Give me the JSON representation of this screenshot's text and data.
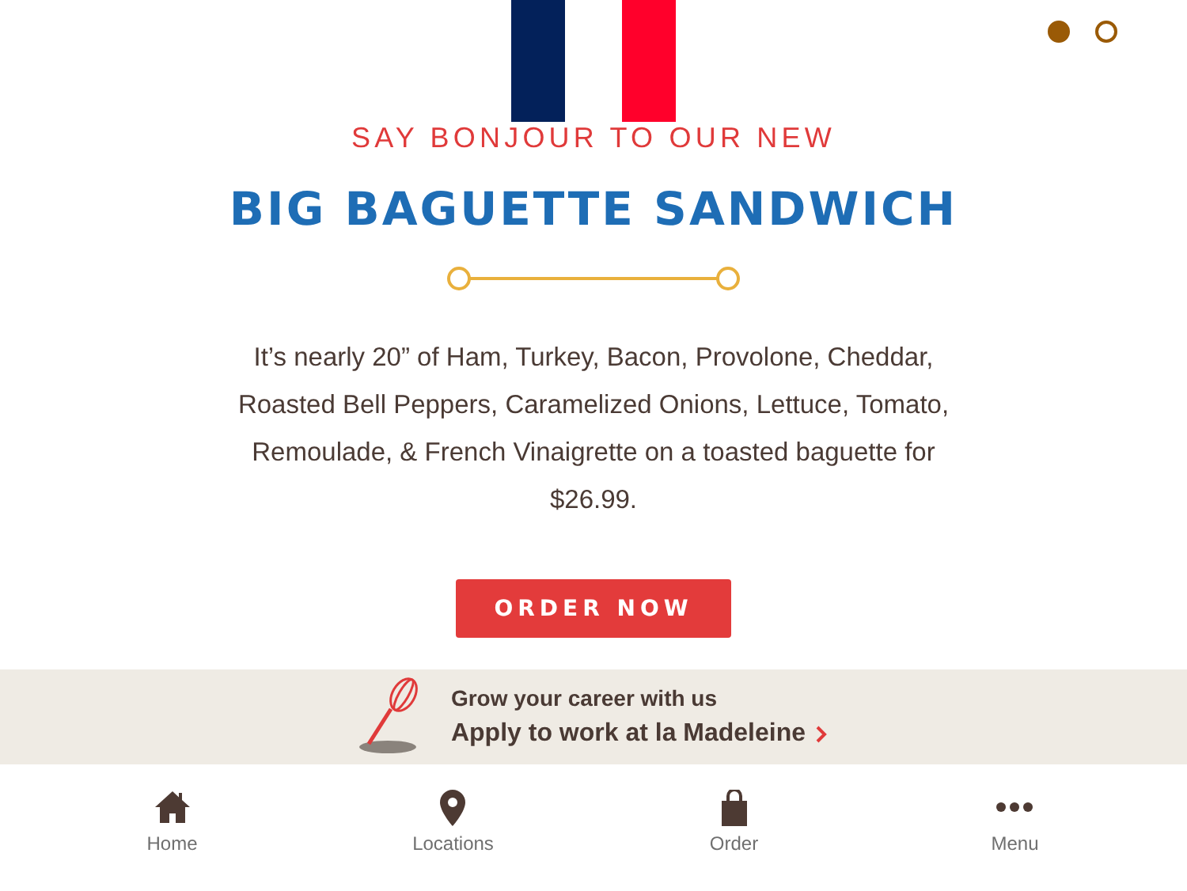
{
  "carousel_dots": [
    {
      "selected": true
    },
    {
      "selected": false
    }
  ],
  "promo": {
    "eyebrow": "SAY BONJOUR TO OUR NEW",
    "title": "BIG BAGUETTE SANDWICH",
    "description": "It’s nearly 20” of Ham, Turkey, Bacon, Provolone, Cheddar, Roasted Bell Peppers, Caramelized Onions, Lettuce, Tomato, Remoulade, & French Vinaigrette on a toasted baguette for $26.99.",
    "button": "ORDER NOW"
  },
  "career_banner": {
    "heading": "Grow your career with us",
    "link": "Apply to work at la Madeleine"
  },
  "bottom_nav": [
    {
      "kind": "home",
      "label": "Home"
    },
    {
      "kind": "locations",
      "label": "Locations"
    },
    {
      "kind": "order",
      "label": "Order"
    },
    {
      "kind": "menu",
      "label": "Menu"
    }
  ]
}
